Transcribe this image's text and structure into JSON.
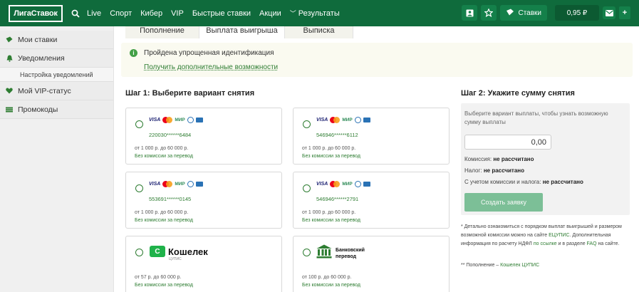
{
  "header": {
    "logo": "ЛигаСтавок",
    "nav": [
      "Live",
      "Спорт",
      "Кибер",
      "VIP",
      "Быстрые ставки",
      "Акции"
    ],
    "results": "Результаты",
    "bets": "Ставки",
    "balance": "0,95 ₽",
    "plus": "+",
    "icons": [
      "search-icon",
      "profile-icon",
      "star-icon",
      "ticket-icon",
      "mail-icon"
    ]
  },
  "sidebar": {
    "items": [
      {
        "label": "Мои ставки",
        "icon": "ticket-icon"
      },
      {
        "label": "Уведомления",
        "icon": "bell-icon"
      },
      {
        "label": "Настройка уведомлений"
      },
      {
        "label": "Мой VIP-статус",
        "icon": "heart-icon"
      },
      {
        "label": "Промокоды",
        "icon": "promo-icon"
      }
    ]
  },
  "tabs": [
    "Пополнение",
    "Выплата выигрыша",
    "Выписка"
  ],
  "notice": {
    "text": "Пройдена упрощенная идентификация",
    "link": "Получить дополнительные возможности"
  },
  "step1": {
    "title": "Шаг 1: Выберите вариант снятия",
    "methods": [
      {
        "number": "220030******6484",
        "limit": "от 1 000 р. до 60 000 р.",
        "commission": "Без комиссии за перевод"
      },
      {
        "number": "546946******6112",
        "limit": "от 1 000 р. до 60 000 р.",
        "commission": "Без комиссии за перевод"
      },
      {
        "number": "553691******0145",
        "limit": "от 1 000 р. до 60 000 р.",
        "commission": "Без комиссии за перевод"
      },
      {
        "number": "546946******2791",
        "limit": "от 1 000 р. до 60 000 р.",
        "commission": "Без комиссии за перевод"
      },
      {
        "brand": "Кошелек",
        "brand_sub": "ЦУПИС",
        "limit": "от 57 р. до 60 000 р.",
        "commission": "Без комиссии за перевод"
      },
      {
        "brand": "Банковский перевод",
        "limit": "от 100 р. до 60 000 р.",
        "commission": "Без комиссии за перевод"
      }
    ],
    "card_logos": [
      "VISA",
      "mastercard",
      "МИР"
    ]
  },
  "step2": {
    "title": "Шаг 2: Укажите сумму снятия",
    "hint": "Выберите вариант выплаты, чтобы узнать возможную сумму выплаты",
    "amount": "0,00",
    "commission_label": "Комиссия:",
    "commission_value": "не рассчитано",
    "tax_label": "Налог:",
    "tax_value": "не рассчитано",
    "total_label": "С учетом комиссии и налога:",
    "total_value": "не рассчитано",
    "submit": "Создать заявку"
  },
  "footnote": {
    "p1_a": "* Детально ознакомиться с порядком выплат выигрышей и размером возможной комиссии можно на сайте",
    "p1_link1": "ЕЦУПИС",
    "p1_b": ". Дополнительная информация по расчету НДФЛ",
    "p1_link2": "по ссылке",
    "p1_c": "и в разделе",
    "p1_link3": "FAQ",
    "p1_d": "на сайте.",
    "p2_a": "** Пополнение –",
    "p2_link": "Кошелек ЦУПИС"
  },
  "colors": {
    "brand": "#0f6b3c",
    "accent": "#2e7d32",
    "button": "#2e9e5b"
  }
}
